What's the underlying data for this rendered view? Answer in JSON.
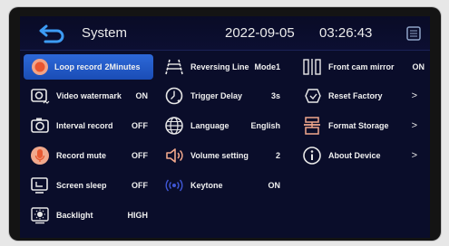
{
  "header": {
    "title": "System",
    "date": "2022-09-05",
    "time": "03:26:43"
  },
  "icons": {
    "back": "back-arrow-icon",
    "sd": "sd-card-icon"
  },
  "colors": {
    "background": "#0a0d2a",
    "selected": "#2d68d8",
    "text": "#f0f0f0"
  },
  "column1": [
    {
      "label": "Loop record",
      "value": "2Minutes",
      "icon": "loop-record-icon",
      "selected": true
    },
    {
      "label": "Video watermark",
      "value": "ON",
      "icon": "watermark-icon"
    },
    {
      "label": "Interval record",
      "value": "OFF",
      "icon": "interval-record-icon"
    },
    {
      "label": "Record mute",
      "value": "OFF",
      "icon": "microphone-icon"
    },
    {
      "label": "Screen sleep",
      "value": "OFF",
      "icon": "screen-sleep-icon"
    },
    {
      "label": "Backlight",
      "value": "HIGH",
      "icon": "backlight-icon"
    }
  ],
  "column2": [
    {
      "label": "Reversing Line",
      "value": "Mode1",
      "icon": "reversing-line-icon"
    },
    {
      "label": "Trigger Delay",
      "value": "3s",
      "icon": "trigger-delay-icon"
    },
    {
      "label": "Language",
      "value": "English",
      "icon": "globe-icon"
    },
    {
      "label": "Volume setting",
      "value": "2",
      "icon": "volume-icon"
    },
    {
      "label": "Keytone",
      "value": "ON",
      "icon": "keytone-icon"
    }
  ],
  "column3": [
    {
      "label": "Front cam mirror",
      "value": "ON",
      "icon": "mirror-icon"
    },
    {
      "label": "Reset Factory",
      "value": ">",
      "icon": "reset-factory-icon"
    },
    {
      "label": "Format Storage",
      "value": ">",
      "icon": "format-storage-icon"
    },
    {
      "label": "About Device",
      "value": ">",
      "icon": "info-icon"
    }
  ]
}
